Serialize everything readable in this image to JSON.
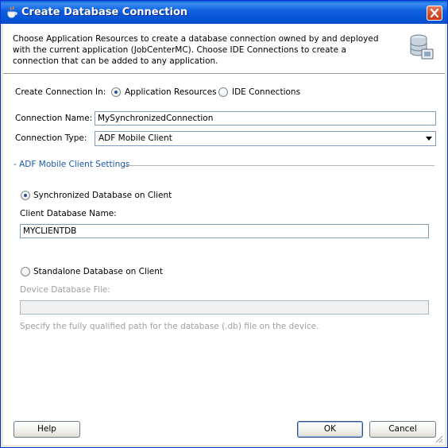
{
  "window": {
    "title": "Create Database Connection",
    "title_icon": "java-cup-icon",
    "close_icon": "close-icon"
  },
  "header": {
    "description": "Choose Application Resources to create a database connection owned by and deployed with the current application (JobCenterMC). Choose IDE Connections to create a connection that can be added to any application.",
    "icon": "database-connection-icon"
  },
  "create_in": {
    "label": "Create Connection In:",
    "options": [
      {
        "label": "Application Resources",
        "selected": true
      },
      {
        "label": "IDE Connections",
        "selected": false
      }
    ]
  },
  "connection_name": {
    "label": "Connection Name:",
    "value": "MySynchronizedConnection"
  },
  "connection_type": {
    "label": "Connection Type:",
    "value": "ADF Mobile Client"
  },
  "settings": {
    "section_title": "- ADF Mobile Client Settings",
    "synchronized": {
      "label": "Synchronized Database on Client",
      "selected": true,
      "db_name_label": "Client Database Name:",
      "db_name_value": "MYCLIENTDB"
    },
    "standalone": {
      "label": "Standalone Database on Client",
      "selected": false,
      "file_label": "Device Database File:",
      "file_value": "",
      "hint": "Specify the fully qualified path for the database (.db) file on the device."
    }
  },
  "buttons": {
    "help": "Help",
    "ok": "OK",
    "cancel": "Cancel"
  },
  "colors": {
    "titlebar": "#0553d6",
    "section_title": "#1c58a8",
    "dialog_bg": "#ffffff"
  }
}
